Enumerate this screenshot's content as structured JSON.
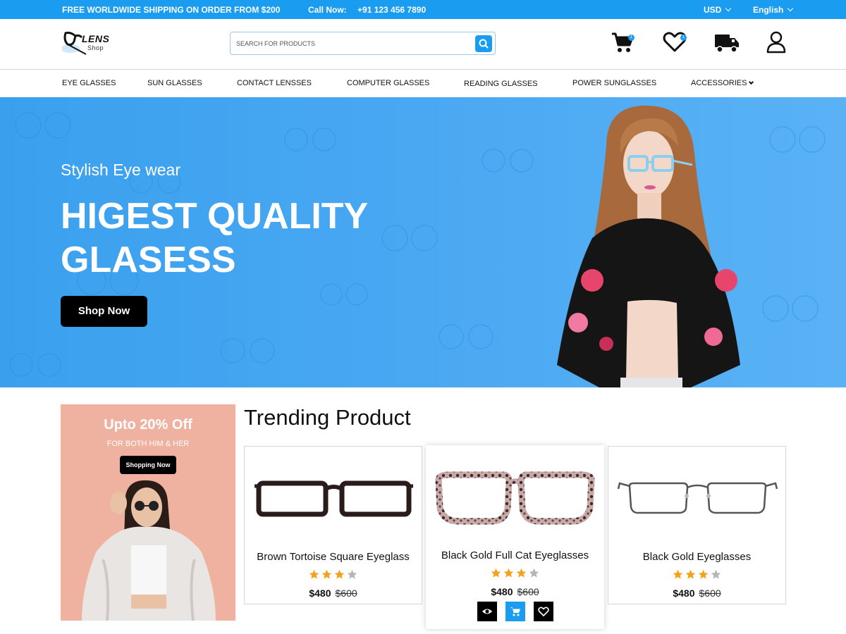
{
  "topbar": {
    "shipping": "FREE WORLDWIDE SHIPPING ON ORDER FROM $200",
    "call_label": "Call Now:",
    "phone": "+91 123 456 7890",
    "currency": "USD",
    "language": "English"
  },
  "header": {
    "logo_main": "LENS",
    "logo_sub": "Shop",
    "search_placeholder": "SEARCH FOR PRODUCTS",
    "cart_count": "1",
    "wishlist_count": "1"
  },
  "nav": {
    "items": [
      "EYE GLASSES",
      "SUN GLASSES",
      "CONTACT LENSSES",
      "COMPUTER GLASSES",
      "READING GLASSES",
      "POWER SUNGLASSES",
      "ACCESSORIES"
    ]
  },
  "hero": {
    "subtitle": "Stylish Eye wear",
    "title": "HIGEST QUALITY GLASESS",
    "button": "Shop Now"
  },
  "promo": {
    "title": "Upto 20% Off",
    "subtitle": "FOR BOTH HIM & HER",
    "button": "Shopping Now"
  },
  "trending": {
    "title": "Trending Product",
    "products": [
      {
        "name": "Brown Tortoise Square Eyeglass",
        "price": "$480",
        "old_price": "$600",
        "rating": 3
      },
      {
        "name": "Black Gold Full Cat Eyeglasses",
        "price": "$480",
        "old_price": "$600",
        "rating": 3
      },
      {
        "name": "Black Gold Eyeglasses",
        "price": "$480",
        "old_price": "$600",
        "rating": 3
      }
    ]
  },
  "colors": {
    "accent": "#1a9cf0",
    "star_on": "#f4a21d",
    "star_off": "#b5b5b5",
    "promo_bg": "#f0b2a0"
  }
}
